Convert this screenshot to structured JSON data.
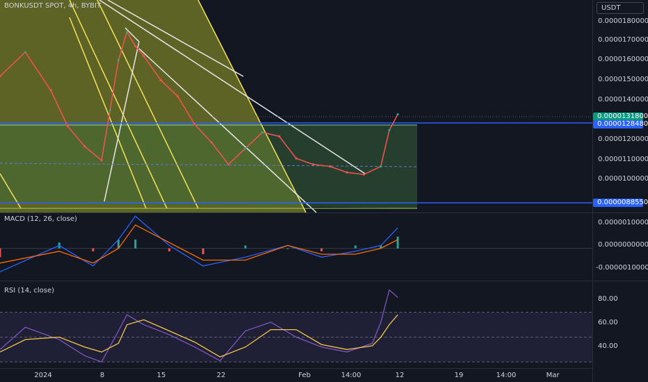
{
  "header": {
    "symbol": "BONKUSDT SPOT, 4h, BYBIT",
    "currency_button": "USDT"
  },
  "chart_data": [
    {
      "type": "line",
      "panel": "price",
      "x_unit": "date",
      "xlim": [
        "2023-12-26",
        "2024-03-05"
      ],
      "ylim": [
        8.2e-06,
        1.88e-05
      ],
      "y_ticks": [
        "0.0000180000",
        "0.0000170000",
        "0.0000160000",
        "0.0000150000",
        "0.0000140000",
        "0.0000120000",
        "0.0000110000",
        "0.0000100000"
      ],
      "x_tick_labels": [
        "2024",
        "8",
        "15",
        "22",
        "Feb",
        "14:00",
        "12",
        "19",
        "14:00",
        "Mar"
      ],
      "series": [
        {
          "x": [
            "2023-12-26",
            "2023-12-29",
            "2024-01-01",
            "2024-01-03",
            "2024-01-05",
            "2024-01-07",
            "2024-01-08",
            "2024-01-09",
            "2024-01-10",
            "2024-01-11",
            "2024-01-12",
            "2024-01-14",
            "2024-01-16",
            "2024-01-18",
            "2024-01-20",
            "2024-01-22",
            "2024-01-24",
            "2024-01-26",
            "2024-01-28",
            "2024-01-30",
            "2024-02-01",
            "2024-02-03",
            "2024-02-05",
            "2024-02-07",
            "2024-02-09",
            "2024-02-10",
            "2024-02-11"
          ],
          "values": [
            1.5e-05,
            1.62e-05,
            1.43e-05,
            1.25e-05,
            1.15e-05,
            1.08e-05,
            1.33e-05,
            1.58e-05,
            1.72e-05,
            1.65e-05,
            1.6e-05,
            1.48e-05,
            1.4e-05,
            1.26e-05,
            1.17e-05,
            1.06e-05,
            1.14e-05,
            1.22e-05,
            1.2e-05,
            1.09e-05,
            1.06e-05,
            1.05e-05,
            1.02e-05,
            1.01e-05,
            1.05e-05,
            1.23e-05,
            1.31e-05
          ]
        }
      ],
      "price_badges": [
        {
          "value": "0.0000131800",
          "color": "#089981"
        },
        {
          "value": "0.0000128480",
          "color": "#2962ff"
        },
        {
          "value": "0.0000088550",
          "color": "#2962ff"
        }
      ]
    },
    {
      "type": "line",
      "panel": "macd",
      "title": "MACD (12, 26, close)",
      "ylim": [
        -1.1e-06,
        1.2e-06
      ],
      "y_ticks": [
        "0.0000010000",
        "0.0000000000",
        "-0.0000010000"
      ],
      "series": [
        {
          "x": [
            "2023-12-26",
            "2024-01-02",
            "2024-01-06",
            "2024-01-09",
            "2024-01-11",
            "2024-01-15",
            "2024-01-19",
            "2024-01-24",
            "2024-01-29",
            "2024-02-02",
            "2024-02-06",
            "2024-02-09",
            "2024-02-11"
          ],
          "values": [
            -8e-07,
            1e-07,
            -6e-07,
            3e-07,
            1.1e-06,
            1e-07,
            -6e-07,
            -3e-07,
            1e-07,
            -3e-07,
            -1e-07,
            1e-07,
            7e-07
          ]
        },
        {
          "x": [
            "2023-12-26",
            "2024-01-02",
            "2024-01-06",
            "2024-01-09",
            "2024-01-11",
            "2024-01-15",
            "2024-01-19",
            "2024-01-24",
            "2024-01-29",
            "2024-02-02",
            "2024-02-06",
            "2024-02-09",
            "2024-02-11"
          ],
          "values": [
            -5e-07,
            -1e-07,
            -5e-07,
            0.0,
            8e-07,
            2e-07,
            -4e-07,
            -4e-07,
            1e-07,
            -2e-07,
            -2e-07,
            0.0,
            3e-07
          ]
        }
      ]
    },
    {
      "type": "line",
      "panel": "rsi",
      "title": "RSI (14, close)",
      "ylim": [
        25,
        95
      ],
      "y_ticks": [
        "80.00",
        "60.00",
        "40.00"
      ],
      "series": [
        {
          "x": [
            "2023-12-26",
            "2023-12-29",
            "2024-01-02",
            "2024-01-05",
            "2024-01-07",
            "2024-01-09",
            "2024-01-10",
            "2024-01-12",
            "2024-01-15",
            "2024-01-18",
            "2024-01-21",
            "2024-01-24",
            "2024-01-27",
            "2024-01-30",
            "2024-02-02",
            "2024-02-05",
            "2024-02-08",
            "2024-02-09",
            "2024-02-10",
            "2024-02-11"
          ],
          "values": [
            40,
            58,
            48,
            35,
            30,
            55,
            68,
            60,
            52,
            42,
            31,
            55,
            62,
            50,
            42,
            38,
            45,
            62,
            88,
            82
          ]
        },
        {
          "x": [
            "2023-12-26",
            "2023-12-29",
            "2024-01-02",
            "2024-01-05",
            "2024-01-07",
            "2024-01-09",
            "2024-01-10",
            "2024-01-12",
            "2024-01-15",
            "2024-01-18",
            "2024-01-21",
            "2024-01-24",
            "2024-01-27",
            "2024-01-30",
            "2024-02-02",
            "2024-02-05",
            "2024-02-08",
            "2024-02-09",
            "2024-02-10",
            "2024-02-11"
          ],
          "values": [
            38,
            48,
            50,
            42,
            38,
            45,
            60,
            64,
            55,
            46,
            34,
            42,
            56,
            56,
            44,
            40,
            43,
            50,
            60,
            68
          ]
        }
      ]
    }
  ]
}
